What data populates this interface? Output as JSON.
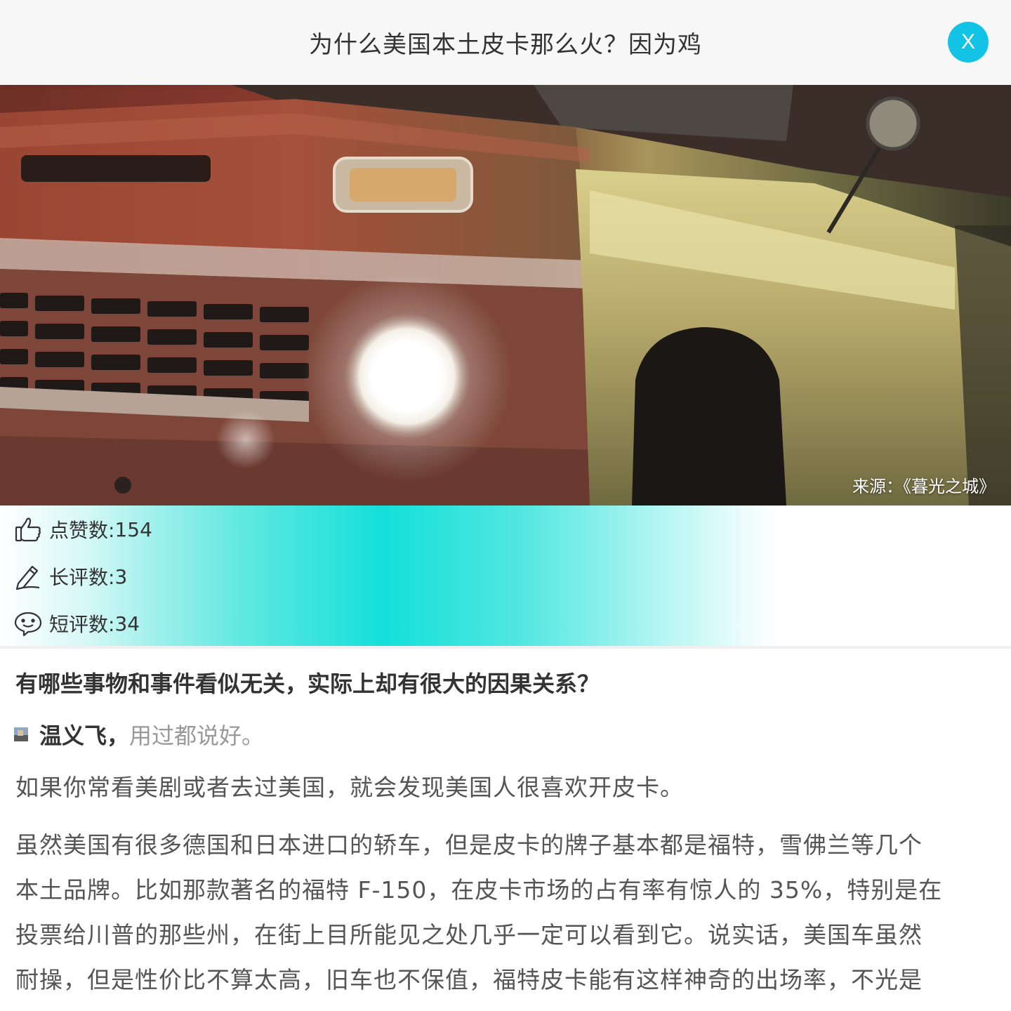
{
  "header": {
    "title": "为什么美国本土皮卡那么火？因为鸡",
    "close_label": "X"
  },
  "hero": {
    "caption": "来源：《暮光之城》"
  },
  "stats": {
    "likes_label": "点赞数: ",
    "likes_value": "154",
    "long_reviews_label": "长评数: ",
    "long_reviews_value": "3",
    "short_reviews_label": "短评数: ",
    "short_reviews_value": "34"
  },
  "article": {
    "question": "有哪些事物和事件看似无关，实际上却有很大的因果关系？",
    "author_name": "温义飞，",
    "author_bio": "用过都说好。",
    "paragraph_1": "如果你常看美剧或者去过美国，就会发现美国人很喜欢开皮卡。",
    "paragraph_2_lines": [
      "虽然美国有很多德国和日本进口的轿车，但是皮卡的牌子基本都是福特，雪佛兰等几个",
      "本土品牌。比如那款著名的福特 F-150，在皮卡市场的占有率有惊人的 35%，特别是在",
      "投票给川普的那些州，在街上目所能见之处几乎一定可以看到它。说实话，美国车虽然",
      "耐操，但是性价比不算太高，旧车也不保值，福特皮卡能有这样神奇的出场率，不光是"
    ]
  },
  "colors": {
    "accent": "#12c3e6",
    "stats_highlight": "#14dfd9"
  },
  "icons": {
    "like": "thumbs-up-icon",
    "long_review": "pencil-icon",
    "short_review": "chat-smile-icon",
    "close": "close-icon"
  }
}
